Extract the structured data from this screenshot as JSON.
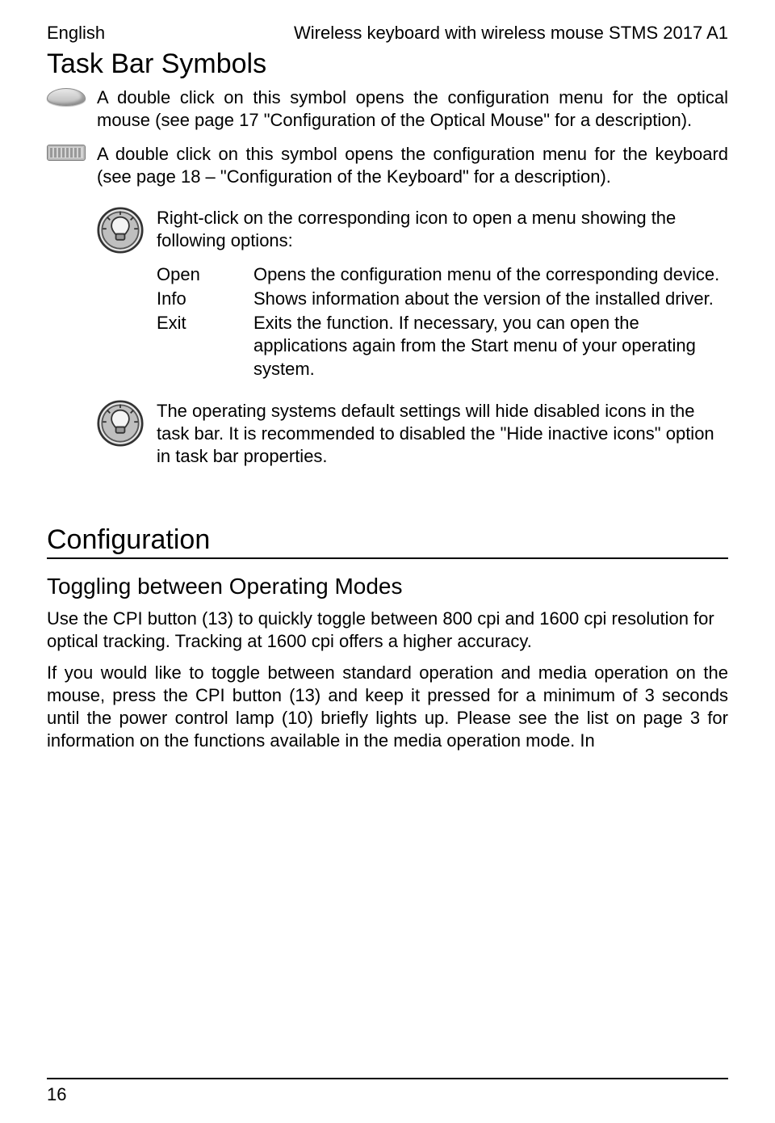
{
  "header": {
    "left": "English",
    "right": "Wireless keyboard with wireless mouse STMS 2017 A1"
  },
  "section_taskbar": {
    "title": "Task Bar Symbols",
    "mouse_text": "A double click on this symbol opens the configuration menu for the optical mouse (see page 17 \"Configuration of the Optical Mouse\" for a description).",
    "keyboard_text": "A double click on this symbol opens the configuration menu for the keyboard (see page 18 – \"Configuration of the Keyboard\" for a description)."
  },
  "tip1": {
    "intro": "Right-click on the corresponding icon to open a menu showing the following options:",
    "options": [
      {
        "term": "Open",
        "desc": "Opens the configuration menu of the corresponding device."
      },
      {
        "term": "Info",
        "desc": "Shows information about the version of the installed driver."
      },
      {
        "term": "Exit",
        "desc": "Exits the function. If necessary, you can open the applications again from the Start menu of your operating system."
      }
    ]
  },
  "tip2": {
    "text": "The operating systems default settings will hide disabled icons in the task bar. It is recommended to disabled the \"Hide inactive icons\" option in task bar properties."
  },
  "section_config": {
    "title": "Configuration",
    "sub": "Toggling between Operating Modes",
    "p1": "Use the CPI button (13) to quickly toggle between 800 cpi and 1600 cpi resolution for optical tracking. Tracking at 1600 cpi offers a higher accuracy.",
    "p2": "If you would like to toggle between standard operation and media operation on the mouse, press the CPI button (13) and keep it pressed for a minimum of 3 seconds until the power control lamp (10) briefly lights up. Please see the list on page 3 for information on the functions available in the media operation mode. In"
  },
  "footer": {
    "page": "16"
  },
  "icons": {
    "mouse": "mouse-icon",
    "keyboard": "keyboard-icon",
    "bulb": "lightbulb-tip-icon"
  }
}
